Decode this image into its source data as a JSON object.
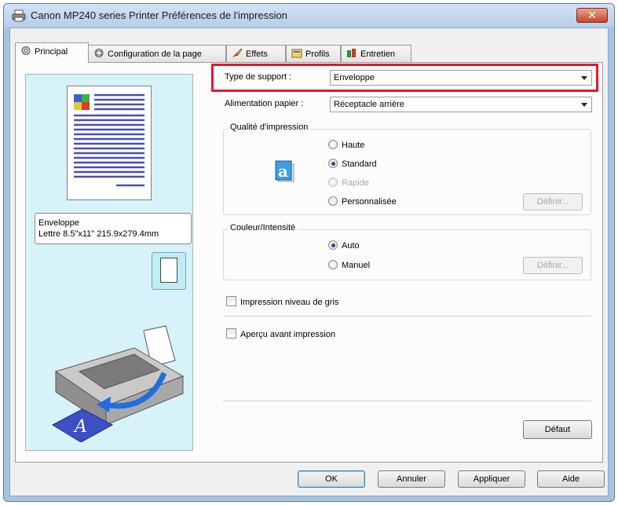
{
  "window": {
    "title": "Canon MP240 series Printer Préférences de l'impression",
    "close_label": "✕"
  },
  "tabs": [
    {
      "label": "Principal",
      "active": true
    },
    {
      "label": "Configuration de la page",
      "active": false
    },
    {
      "label": "Effets",
      "active": false
    },
    {
      "label": "Profils",
      "active": false
    },
    {
      "label": "Entretien",
      "active": false
    }
  ],
  "preview": {
    "paper_type": "Enveloppe",
    "paper_size": "Lettre 8.5\"x11\" 215.9x279.4mm"
  },
  "main": {
    "media_type": {
      "label": "Type de support :",
      "value": "Enveloppe"
    },
    "paper_source": {
      "label": "Alimentation papier :",
      "value": "Réceptacle arrière"
    },
    "quality": {
      "title": "Qualité d'impression",
      "options": [
        "Haute",
        "Standard",
        "Rapide",
        "Personnalisée"
      ],
      "selected": "Standard",
      "set_button": "Définir..."
    },
    "color": {
      "title": "Couleur/Intensité",
      "options": [
        "Auto",
        "Manuel"
      ],
      "selected": "Auto",
      "set_button": "Définir..."
    },
    "grayscale_label": "Impression niveau de gris",
    "preview_label": "Aperçu avant impression",
    "defaults_button": "Défaut"
  },
  "footer": {
    "ok": "OK",
    "cancel": "Annuler",
    "apply": "Appliquer",
    "help": "Aide"
  },
  "colors": {
    "highlight": "#e8162b",
    "preview_bg": "#d7f2f8",
    "title_bar": "#b5cde8"
  }
}
